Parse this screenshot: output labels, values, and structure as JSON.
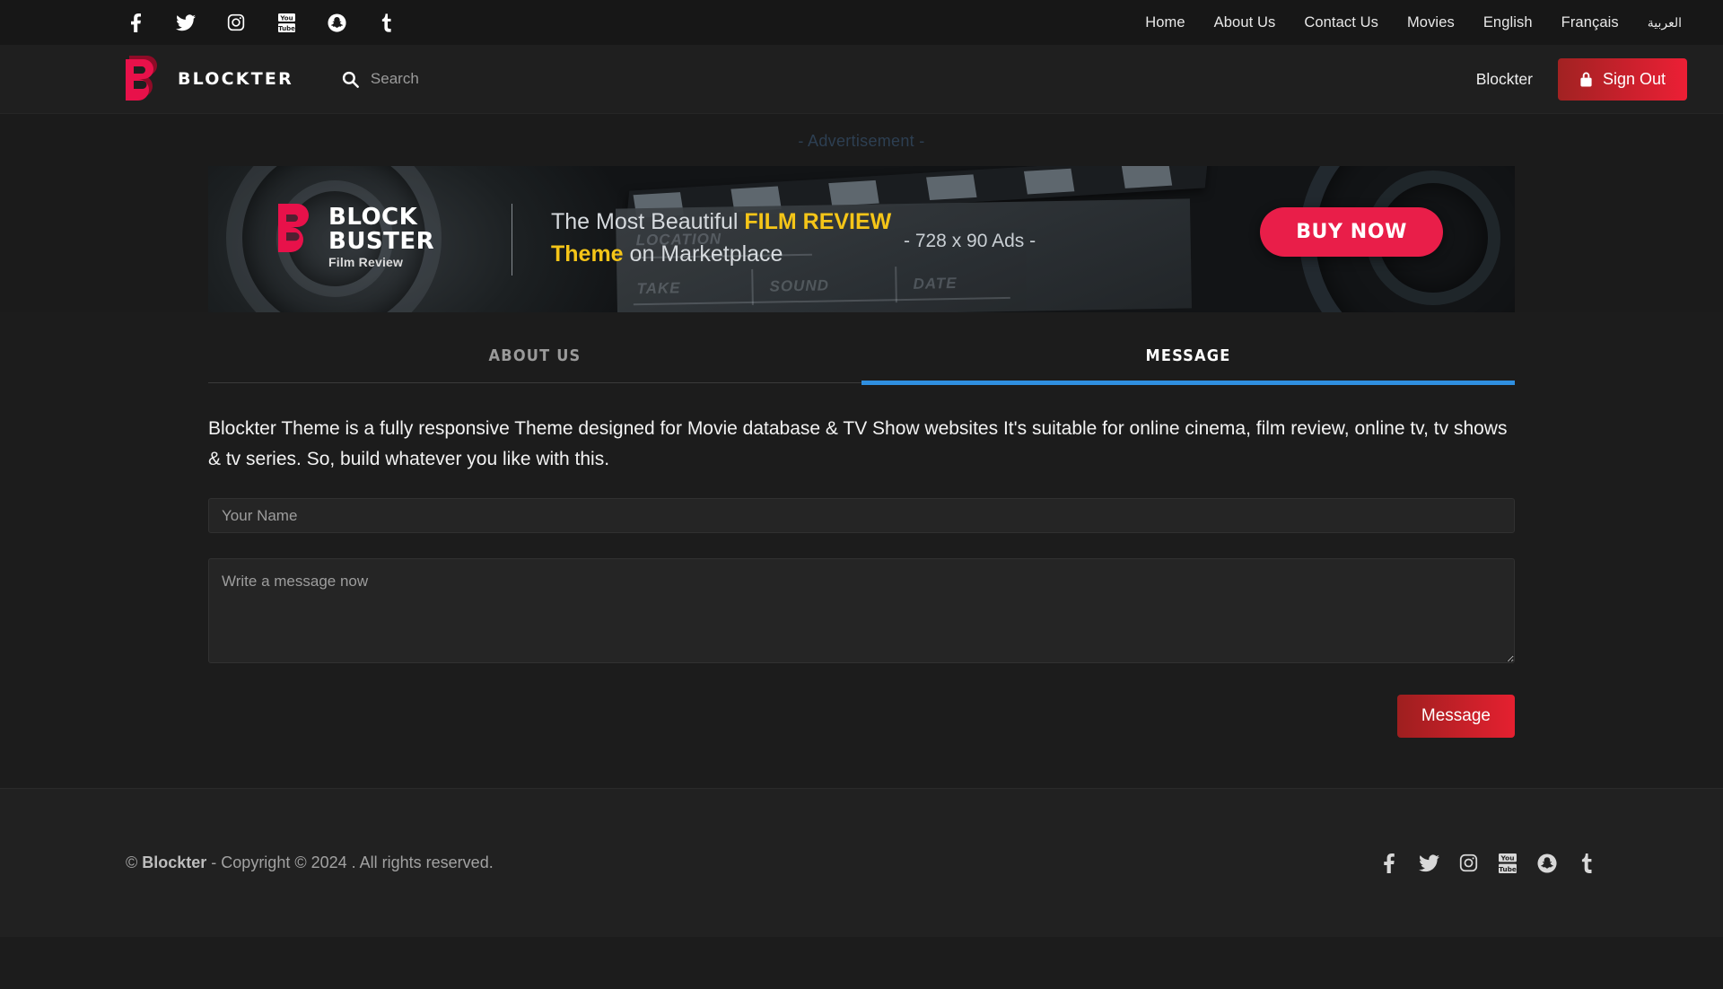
{
  "topbar": {
    "social": [
      {
        "name": "facebook",
        "icon": "facebook-icon"
      },
      {
        "name": "twitter",
        "icon": "twitter-icon"
      },
      {
        "name": "instagram",
        "icon": "instagram-icon"
      },
      {
        "name": "youtube",
        "icon": "youtube-icon"
      },
      {
        "name": "snapchat",
        "icon": "snapchat-icon"
      },
      {
        "name": "tumblr",
        "icon": "tumblr-icon"
      }
    ],
    "nav": [
      {
        "label": "Home"
      },
      {
        "label": "About Us"
      },
      {
        "label": "Contact Us"
      },
      {
        "label": "Movies"
      },
      {
        "label": "English"
      },
      {
        "label": "Français"
      },
      {
        "label": "العربية"
      }
    ]
  },
  "header": {
    "brand_text": "BLOCKTER",
    "brand_logo_letter": "B",
    "search": {
      "placeholder": "Search",
      "value": "",
      "icon": "search-icon"
    },
    "username": "Blockter",
    "signout_label": "Sign Out",
    "signout_icon": "lock-icon"
  },
  "ad": {
    "label": "- Advertisement -",
    "logo_letter": "B",
    "logo_line1": "BLOCK",
    "logo_line2": "BUSTER",
    "logo_line3": "Film Review",
    "copy_line1_plain": "The Most Beautiful ",
    "copy_line1_highlight": "FILM REVIEW",
    "copy_line2_highlight": "Theme",
    "copy_line2_plain": " on Marketplace",
    "size_text": "- 728 x 90 Ads -",
    "cta_label": "BUY NOW",
    "clapper_location": "LOCATION",
    "clapper_take": "TAKE",
    "clapper_sound": "SOUND",
    "clapper_date": "DATE"
  },
  "main": {
    "tabs": [
      {
        "label": "ABOUT US",
        "active": false
      },
      {
        "label": "MESSAGE",
        "active": true
      }
    ],
    "intro": "Blockter Theme is a fully responsive Theme designed for Movie database & TV Show websites It's suitable for online cinema, film review, online tv, tv shows & tv series. So, build whatever you like with this.",
    "form": {
      "name_placeholder": "Your Name",
      "name_value": "",
      "message_placeholder": "Write a message now",
      "message_value": "",
      "submit_label": "Message"
    }
  },
  "footer": {
    "copyright_prefix": "© ",
    "copyright_brand": "Blockter",
    "copyright_suffix": " - Copyright © 2024 . All rights reserved.",
    "social": [
      {
        "name": "facebook",
        "icon": "facebook-icon"
      },
      {
        "name": "twitter",
        "icon": "twitter-icon"
      },
      {
        "name": "instagram",
        "icon": "instagram-icon"
      },
      {
        "name": "youtube",
        "icon": "youtube-icon"
      },
      {
        "name": "snapchat",
        "icon": "snapchat-icon"
      },
      {
        "name": "tumblr",
        "icon": "tumblr-icon"
      }
    ]
  },
  "colors": {
    "accent_red": "#e91e49",
    "tab_active_underline": "#2f8fe0",
    "ad_highlight": "#f5c518",
    "page_bg": "#1c1c1c"
  }
}
